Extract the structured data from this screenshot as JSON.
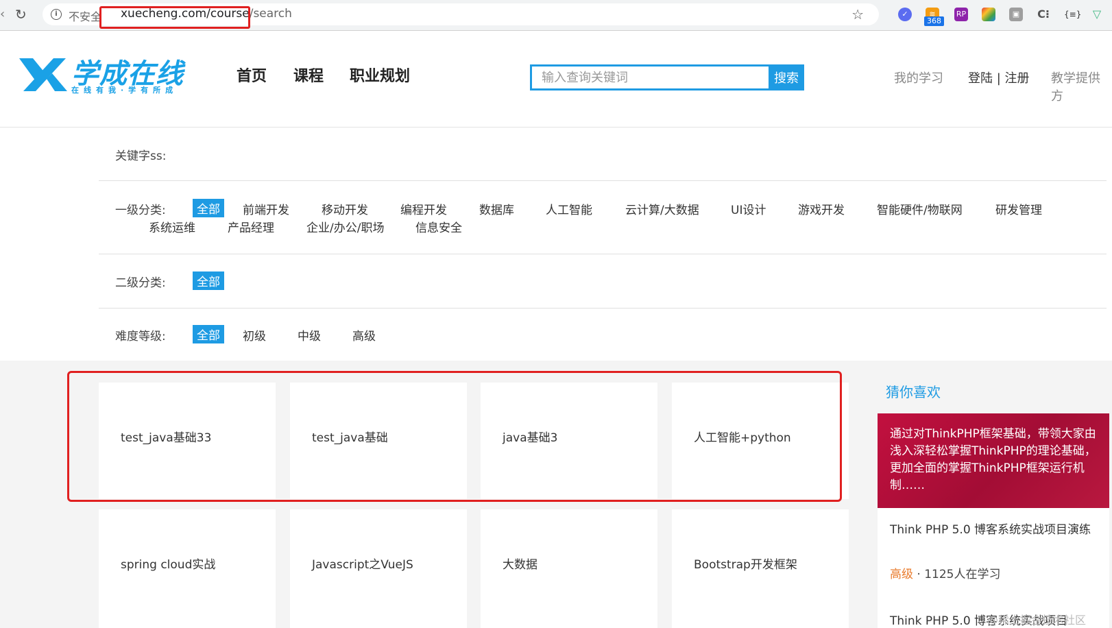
{
  "browser": {
    "insecure_label": "不安全",
    "url_host": "xuecheng.com/course",
    "url_path": "/search",
    "ext_badge": "368"
  },
  "header": {
    "logo_text": "学成在线",
    "logo_sub": "在线有我·学有所成",
    "nav": [
      "首页",
      "课程",
      "职业规划"
    ],
    "search_placeholder": "输入查询关键词",
    "search_button": "搜索",
    "links": {
      "my_learning": "我的学习",
      "login_register": "登陆 | 注册",
      "teaching": "教学提供方"
    }
  },
  "filters": {
    "keyword_label": "关键字ss:",
    "level1_label": "一级分类:",
    "level1_all": "全部",
    "level1_row1": [
      "前端开发",
      "移动开发",
      "编程开发",
      "数据库",
      "人工智能",
      "云计算/大数据",
      "UI设计",
      "游戏开发",
      "智能硬件/物联网",
      "研发管理"
    ],
    "level1_row2": [
      "系统运维",
      "产品经理",
      "企业/办公/职场",
      "信息安全"
    ],
    "level2_label": "二级分类:",
    "level2_all": "全部",
    "difficulty_label": "难度等级:",
    "difficulty_all": "全部",
    "difficulty_options": [
      "初级",
      "中级",
      "高级"
    ]
  },
  "courses": [
    "test_java基础33",
    "test_java基础",
    "java基础3",
    "人工智能+python",
    "spring cloud实战",
    "Javascript之VueJS",
    "大数据",
    "Bootstrap开发框架"
  ],
  "recommend": {
    "title": "猜你喜欢",
    "banner_text": "通过对ThinkPHP框架基础，带领大家由浅入深轻松掌握ThinkPHP的理论基础，更加全面的掌握ThinkPHP框架运行机制……",
    "item1_name": "Think PHP 5.0 博客系统实战项目演练",
    "item1_level": "高级",
    "item1_learners": "1125人在学习",
    "item2_name": "Think PHP 5.0 博客系统实战项目"
  },
  "watermark": "@稀土掘金技术社区",
  "colors": {
    "accent": "#1e9be3",
    "highlight": "#e02020",
    "banner": "#b2113c",
    "level": "#e97b2c"
  }
}
